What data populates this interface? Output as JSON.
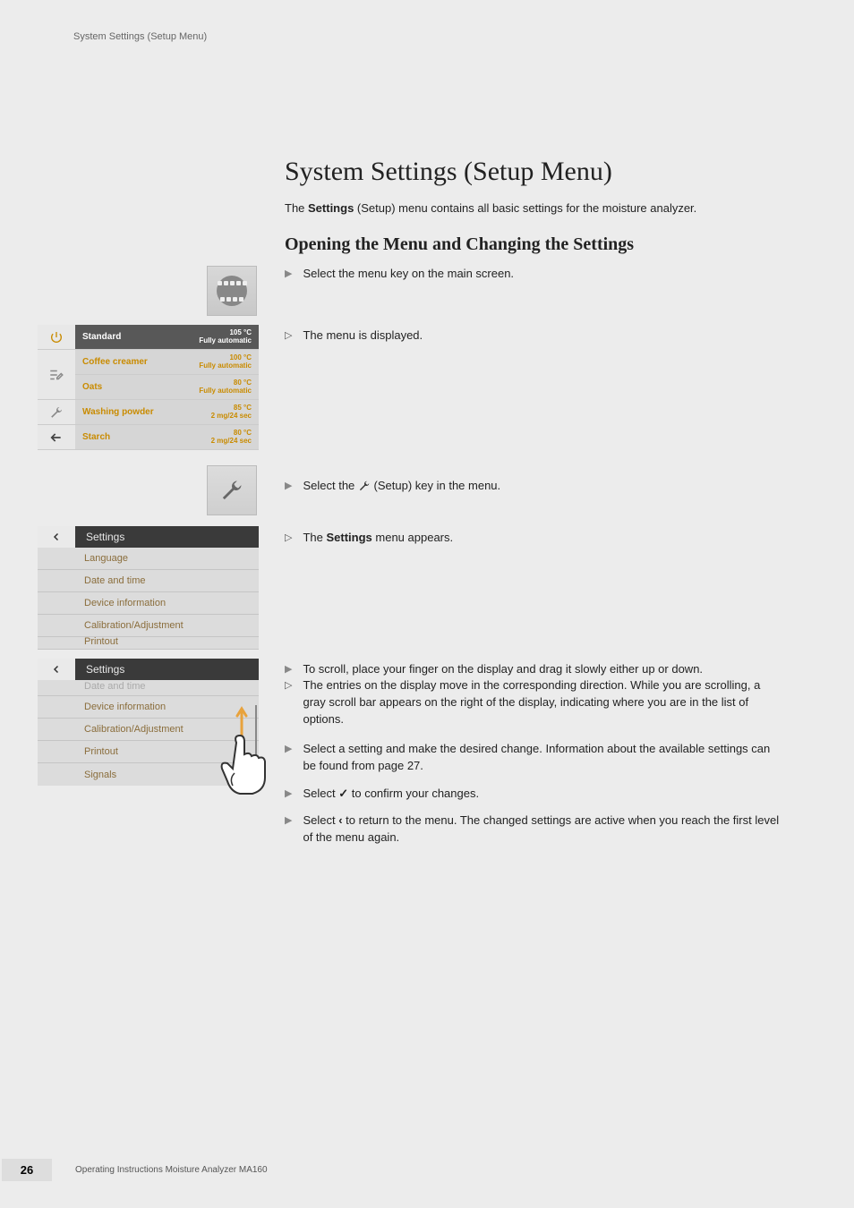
{
  "header": {
    "running_title": "System Settings (Setup Menu)"
  },
  "title": "System Settings (Setup Menu)",
  "intro": {
    "pre": "The ",
    "bold": "Settings",
    "post": " (Setup) menu contains all basic settings for the moisture analyzer."
  },
  "section_title": "Opening the Menu and Changing the Settings",
  "steps": {
    "s1": "Select the menu key on the main screen.",
    "s2": "The menu is displayed.",
    "s3_pre": "Select the ",
    "s3_post": " (Setup) key in the menu.",
    "s4_pre": "The ",
    "s4_bold": "Settings",
    "s4_post": " menu appears.",
    "s5": "To scroll, place your finger on the display and drag it slowly either up or down.",
    "s6": "The entries on the display move in the corresponding direction. While you are scrolling, a gray scroll bar appears on the right of the display, indicating where you are in the list of options.",
    "s7": "Select a setting and make the desired change. Information about the available settings can be found from page 27.",
    "s8_pre": "Select ",
    "s8_post": " to confirm your changes.",
    "s9_pre": "Select ",
    "s9_sym": "‹",
    "s9_post": " to return to the menu. The changed settings are active when you reach the first level of the menu again."
  },
  "device_menu": {
    "items": [
      {
        "name": "Standard",
        "line1": "105 °C",
        "line2": "Fully automatic",
        "selected": true
      },
      {
        "name": "Coffee creamer",
        "line1": "100 °C",
        "line2": "Fully automatic"
      },
      {
        "name": "Oats",
        "line1": "80 °C",
        "line2": "Fully automatic"
      },
      {
        "name": "Washing powder",
        "line1": "85 °C",
        "line2": "2 mg/24 sec"
      },
      {
        "name": "Starch",
        "line1": "80 °C",
        "line2": "2 mg/24 sec"
      }
    ]
  },
  "settings_panel": {
    "title": "Settings",
    "items1": [
      "Language",
      "Date and time",
      "Device information",
      "Calibration/Adjustment",
      "Printout"
    ],
    "items2_cut": "Date and time",
    "items2": [
      "Device information",
      "Calibration/Adjustment",
      "Printout",
      "Signals"
    ]
  },
  "footer": {
    "page": "26",
    "text": "Operating Instructions Moisture Analyzer MA160"
  }
}
